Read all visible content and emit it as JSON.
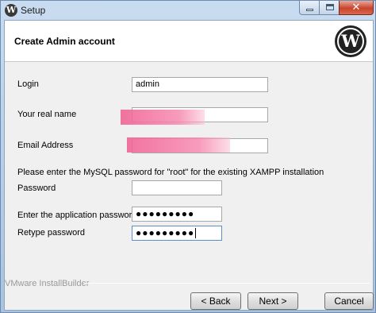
{
  "window": {
    "title": "Setup",
    "app_icon": "wordpress-icon"
  },
  "header": {
    "title": "Create Admin account",
    "logo": "wordpress-logo"
  },
  "form": {
    "login": {
      "label": "Login",
      "value": "admin"
    },
    "real_name": {
      "label": "Your real name",
      "value": ""
    },
    "email": {
      "label": "Email Address",
      "value": ""
    },
    "mysql_note": "Please enter the MySQL password for \"root\" for the existing XAMPP installation",
    "password": {
      "label": "Password",
      "value": ""
    },
    "app_password": {
      "label": "Enter the application password",
      "value": "●●●●●●●●●"
    },
    "retype_password": {
      "label": "Retype password",
      "value": "●●●●●●●●●"
    }
  },
  "footer": {
    "brand": "VMware InstallBuilder"
  },
  "buttons": {
    "back": "< Back",
    "next": "Next >",
    "cancel": "Cancel"
  },
  "colors": {
    "redaction": "#f07096",
    "titlebar": "#bcd3ea",
    "close_button": "#c8442c"
  }
}
